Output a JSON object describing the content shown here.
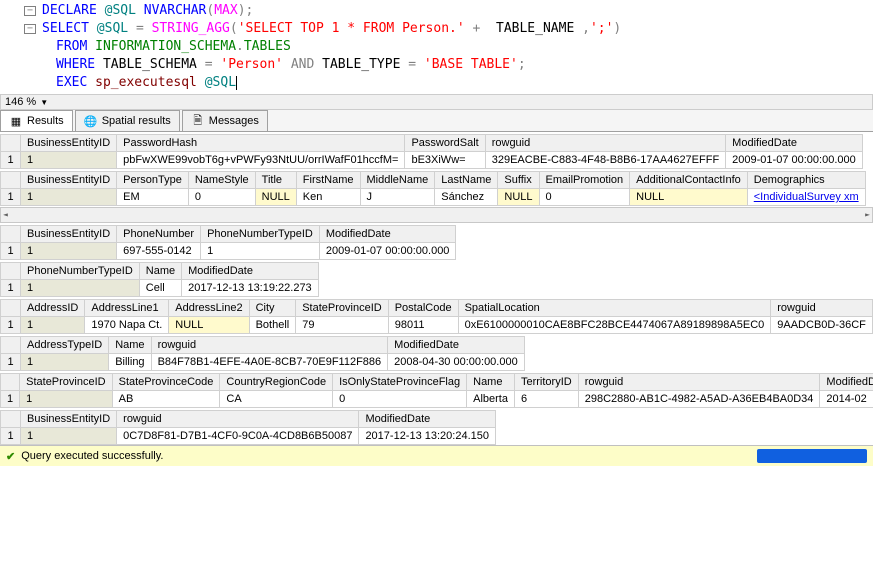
{
  "editor": {
    "line1": {
      "declare": "DECLARE",
      "var": "@SQL",
      "type": "NVARCHAR",
      "max": "MAX"
    },
    "line2": {
      "select": "SELECT",
      "var": "@SQL",
      "eq": "=",
      "fn": "STRING_AGG",
      "str1": "'SELECT TOP 1 * FROM Person.'",
      "plus": "+",
      "col": "TABLE_NAME",
      "comma": ",",
      "str2": "';'"
    },
    "line3": {
      "from": "FROM",
      "schema": "INFORMATION_SCHEMA",
      "dot": ".",
      "tbl": "TABLES"
    },
    "line4": {
      "where": "WHERE",
      "col1": "TABLE_SCHEMA",
      "eq": "=",
      "val1": "'Person'",
      "and": "AND",
      "col2": "TABLE_TYPE",
      "eq2": "=",
      "val2": "'BASE TABLE'",
      "semi": ";"
    },
    "line5": {
      "exec": "EXEC",
      "proc": "sp_executesql",
      "var": "@SQL"
    }
  },
  "zoom": "146 %",
  "tabs": {
    "results": "Results",
    "spatial": "Spatial results",
    "messages": "Messages"
  },
  "t1": {
    "h": [
      "BusinessEntityID",
      "PasswordHash",
      "PasswordSalt",
      "rowguid",
      "ModifiedDate"
    ],
    "r": [
      "1",
      "pbFwXWE99vobT6g+vPWFy93NtUU/orrIWafF01hccfM=",
      "bE3XiWw=",
      "329EACBE-C883-4F48-B8B6-17AA4627EFFF",
      "2009-01-07 00:00:00.000"
    ]
  },
  "t2": {
    "h": [
      "BusinessEntityID",
      "PersonType",
      "NameStyle",
      "Title",
      "FirstName",
      "MiddleName",
      "LastName",
      "Suffix",
      "EmailPromotion",
      "AdditionalContactInfo",
      "Demographics"
    ],
    "r": [
      "1",
      "EM",
      "0",
      "NULL",
      "Ken",
      "J",
      "Sánchez",
      "NULL",
      "0",
      "NULL",
      "<IndividualSurvey xm"
    ],
    "nulls": [
      3,
      7,
      9
    ],
    "link": 10
  },
  "t3": {
    "h": [
      "BusinessEntityID",
      "PhoneNumber",
      "PhoneNumberTypeID",
      "ModifiedDate"
    ],
    "r": [
      "1",
      "697-555-0142",
      "1",
      "2009-01-07 00:00:00.000"
    ]
  },
  "t4": {
    "h": [
      "PhoneNumberTypeID",
      "Name",
      "ModifiedDate"
    ],
    "r": [
      "1",
      "Cell",
      "2017-12-13 13:19:22.273"
    ]
  },
  "t5": {
    "h": [
      "AddressID",
      "AddressLine1",
      "AddressLine2",
      "City",
      "StateProvinceID",
      "PostalCode",
      "SpatialLocation",
      "rowguid"
    ],
    "r": [
      "1",
      "1970 Napa Ct.",
      "NULL",
      "Bothell",
      "79",
      "98011",
      "0xE6100000010CAE8BFC28BCE4474067A89189898A5EC0",
      "9AADCB0D-36CF"
    ],
    "nulls": [
      2
    ]
  },
  "t6": {
    "h": [
      "AddressTypeID",
      "Name",
      "rowguid",
      "ModifiedDate"
    ],
    "r": [
      "1",
      "Billing",
      "B84F78B1-4EFE-4A0E-8CB7-70E9F112F886",
      "2008-04-30 00:00:00.000"
    ]
  },
  "t7": {
    "h": [
      "StateProvinceID",
      "StateProvinceCode",
      "CountryRegionCode",
      "IsOnlyStateProvinceFlag",
      "Name",
      "TerritoryID",
      "rowguid",
      "ModifiedDate"
    ],
    "r": [
      "1",
      "AB",
      "CA",
      "0",
      "Alberta",
      "6",
      "298C2880-AB1C-4982-A5AD-A36EB4BA0D34",
      "2014-02"
    ]
  },
  "t8": {
    "h": [
      "BusinessEntityID",
      "rowguid",
      "ModifiedDate"
    ],
    "r": [
      "1",
      "0C7D8F81-D7B1-4CF0-9C0A-4CD8B6B50087",
      "2017-12-13 13:20:24.150"
    ]
  },
  "status": "Query executed successfully."
}
